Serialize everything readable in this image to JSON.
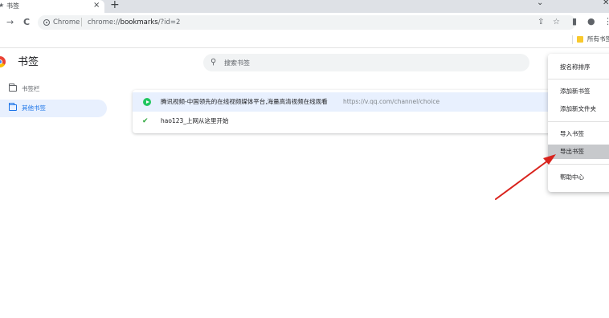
{
  "tab": {
    "favicon": "bookmark-star-icon",
    "title": "书签",
    "close": "×",
    "new_tab": "+"
  },
  "window": {
    "minimize": "⌄",
    "close": "✕"
  },
  "toolbar": {
    "back": "←",
    "forward": "→",
    "reload": "C",
    "site_label": "Chrome",
    "url_host": "chrome://",
    "url_path": "bookmarks",
    "url_query": "/?id=2",
    "share": "⇪",
    "star": "☆",
    "side_panel": "▮",
    "profile": "●",
    "menu": "⋮"
  },
  "bookmarks_bar": {
    "all_bookmarks": "所有书签"
  },
  "header": {
    "title": "书签",
    "search_placeholder": "搜索书签"
  },
  "sidebar": {
    "items": [
      {
        "label": "书签栏",
        "selected": false
      },
      {
        "label": "其他书签",
        "selected": true
      }
    ]
  },
  "bookmarks": [
    {
      "title": "腾讯视频-中国领先的在线视频媒体平台,海量高清视频在线观看",
      "url": "https://v.qq.com/channel/choice",
      "icon": "tencent-video-icon"
    },
    {
      "title": "hao123_上网从这里开始",
      "url": "",
      "icon": "hao123-icon"
    }
  ],
  "menu": {
    "items": [
      {
        "label": "按名称排序"
      },
      {
        "label": "添加新书签"
      },
      {
        "label": "添加新文件夹"
      },
      {
        "label": "导入书签"
      },
      {
        "label": "导出书签",
        "active": true
      },
      {
        "label": "帮助中心"
      }
    ]
  },
  "colors": {
    "accent": "#1a73e8",
    "selected_bg": "#e8f0fe",
    "arrow": "#d9231d"
  }
}
